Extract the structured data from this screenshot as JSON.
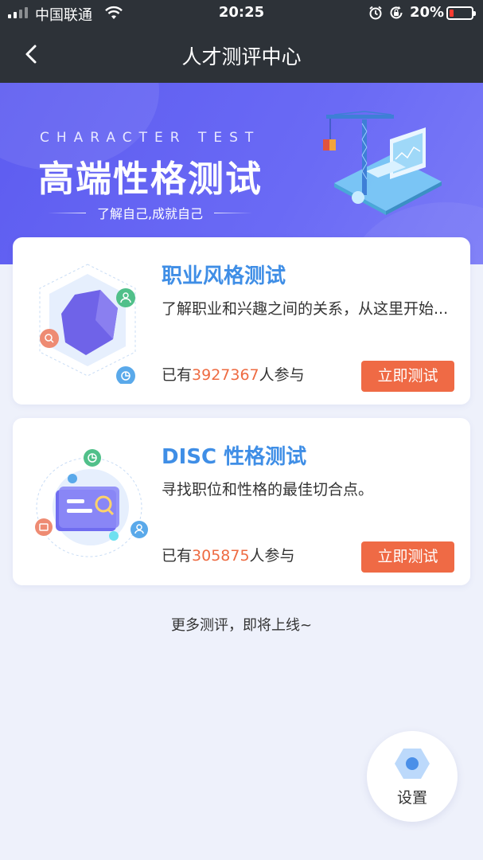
{
  "status_bar": {
    "carrier": "中国联通",
    "time": "20:25",
    "battery_percent": "20%",
    "battery_level": 0.2,
    "battery_color": "#ff3b30"
  },
  "nav": {
    "title": "人才测评中心",
    "back_icon": "chevron-left-icon"
  },
  "banner": {
    "subtitle_en": "CHARACTER TEST",
    "title": "高端性格测试",
    "slogan": "了解自己,成就自己"
  },
  "tests": [
    {
      "title": "职业风格测试",
      "description": "了解职业和兴趣之间的关系，从这里开始...",
      "count_prefix": "已有",
      "count": "3927367",
      "count_suffix": "人参与",
      "button_label": "立即测试"
    },
    {
      "title": "DISC 性格测试",
      "description": "寻找职位和性格的最佳切合点。",
      "count_prefix": "已有",
      "count": "305875",
      "count_suffix": "人参与",
      "button_label": "立即测试"
    }
  ],
  "more_text": "更多测评，即将上线~",
  "settings": {
    "label": "设置",
    "icon": "hexagon-settings-icon"
  },
  "colors": {
    "header_bg": "#2d3238",
    "banner_bg": "#6262f2",
    "title_blue": "#3f8ee6",
    "accent_orange": "#ef6a45",
    "page_bg": "#eef1fb"
  }
}
